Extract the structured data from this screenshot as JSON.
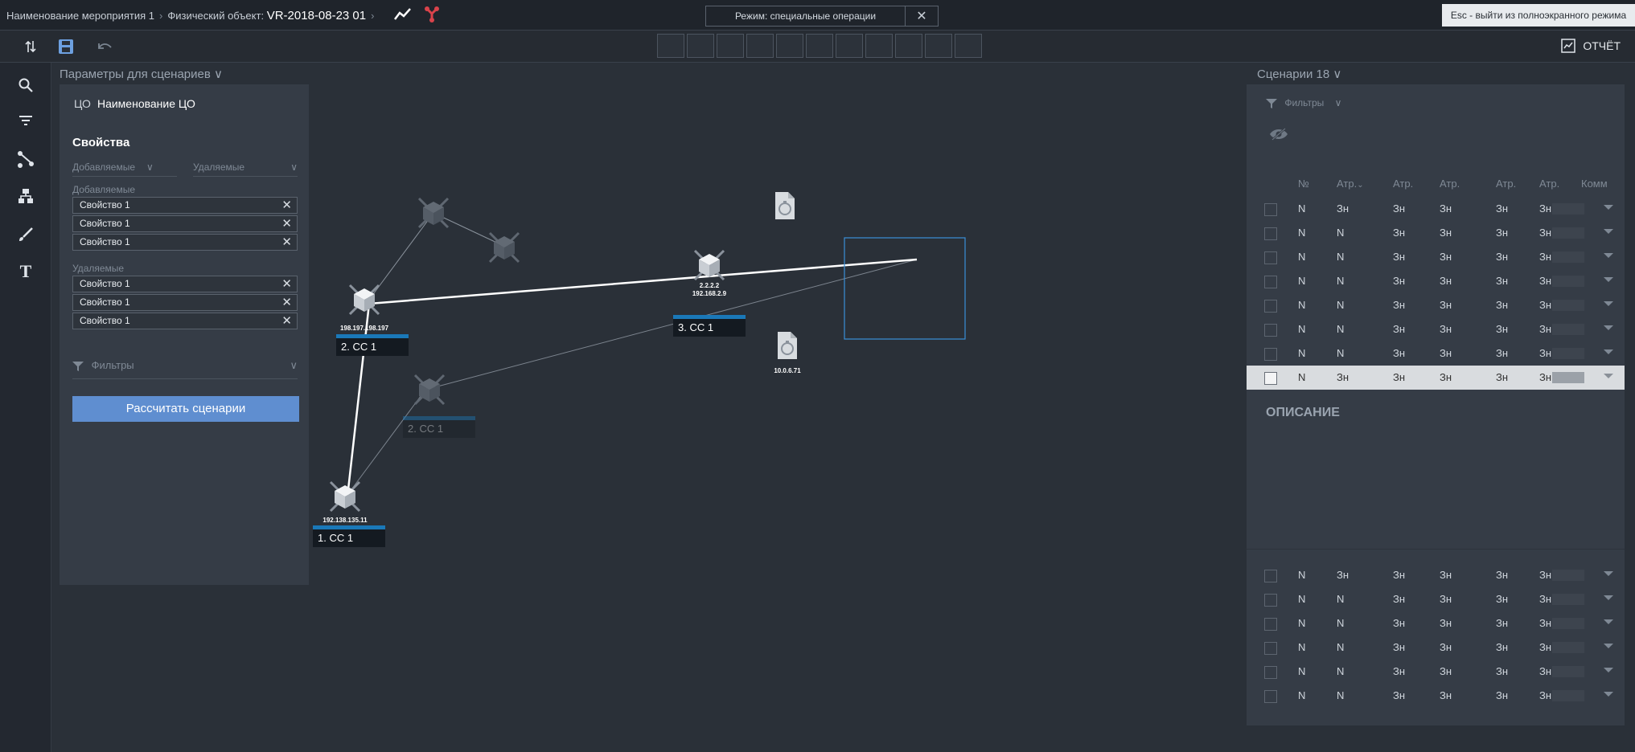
{
  "topbar": {
    "crumb_event": "Наименование мероприятия 1",
    "crumb_object_label": "Физический объект:",
    "crumb_object_value": "VR-2018-08-23 01",
    "mode_label": "Режим:  специальные операции",
    "esc_hint": "Esc - выйти из полноэкранного режима",
    "icons": [
      "trend-line-icon",
      "network-icon"
    ]
  },
  "toolbar": {
    "report_label": "ОТЧЁТ",
    "slot_count": 11,
    "icons": [
      "sort-icon",
      "save-icon",
      "undo-icon",
      "report-icon"
    ]
  },
  "rail": {
    "icons": [
      "search-icon",
      "filter-lines-icon",
      "connect-icon",
      "hierarchy-icon",
      "brush-icon",
      "text-icon"
    ]
  },
  "left_panel": {
    "title": "Параметры для сценариев",
    "co_label": "ЦО",
    "co_name": "Наименование ЦО",
    "props_title": "Свойства",
    "dropdown_added": "Добавляемые",
    "dropdown_removed": "Удаляемые",
    "added_label": "Добавляемые",
    "removed_label": "Удаляемые",
    "added": [
      "Свойство 1",
      "Свойство 1",
      "Свойство 1"
    ],
    "removed": [
      "Свойство 1",
      "Свойство 1",
      "Свойство 1"
    ],
    "filters_label": "Фильтры",
    "calc_button": "Рассчитать сценарии"
  },
  "graph": {
    "nodes": [
      {
        "ip": "198.197.198.197",
        "label": "2.  СС 1"
      },
      {
        "ip": "2.2.2.2",
        "ip2": "192.168.2.9",
        "label": "3.  СС 1"
      },
      {
        "ip": "192.138.135.11",
        "label": "1.  СС 1"
      },
      {
        "label": "2.  СС 1"
      },
      {
        "ip": "10.0.6.71"
      }
    ]
  },
  "right_panel": {
    "title": "Сценарии 18",
    "filters_label": "Фильтры",
    "columns": [
      "№",
      "Атр.",
      "Атр.",
      "Атр.",
      "Атр.",
      "Атр.",
      "Комм"
    ],
    "rows_top": [
      [
        "N",
        "Зн",
        "Зн",
        "Зн",
        "Зн",
        "Зн"
      ],
      [
        "N",
        "N",
        "Зн",
        "Зн",
        "Зн",
        "Зн"
      ],
      [
        "N",
        "N",
        "Зн",
        "Зн",
        "Зн",
        "Зн"
      ],
      [
        "N",
        "N",
        "Зн",
        "Зн",
        "Зн",
        "Зн"
      ],
      [
        "N",
        "N",
        "Зн",
        "Зн",
        "Зн",
        "Зн"
      ],
      [
        "N",
        "N",
        "Зн",
        "Зн",
        "Зн",
        "Зн"
      ],
      [
        "N",
        "N",
        "Зн",
        "Зн",
        "Зн",
        "Зн"
      ],
      [
        "N",
        "Зн",
        "Зн",
        "Зн",
        "Зн",
        "Зн"
      ]
    ],
    "selected_row": 7,
    "description_label": "ОПИСАНИЕ",
    "rows_bottom": [
      [
        "N",
        "Зн",
        "Зн",
        "Зн",
        "Зн",
        "Зн"
      ],
      [
        "N",
        "N",
        "Зн",
        "Зн",
        "Зн",
        "Зн"
      ],
      [
        "N",
        "N",
        "Зн",
        "Зн",
        "Зн",
        "Зн"
      ],
      [
        "N",
        "N",
        "Зн",
        "Зн",
        "Зн",
        "Зн"
      ],
      [
        "N",
        "N",
        "Зн",
        "Зн",
        "Зн",
        "Зн"
      ],
      [
        "N",
        "N",
        "Зн",
        "Зн",
        "Зн",
        "Зн"
      ]
    ]
  },
  "colors": {
    "accent": "#5f8ed0",
    "node_bar": "#1a78b8",
    "bg": "#2a3038",
    "panel": "#353c46"
  }
}
